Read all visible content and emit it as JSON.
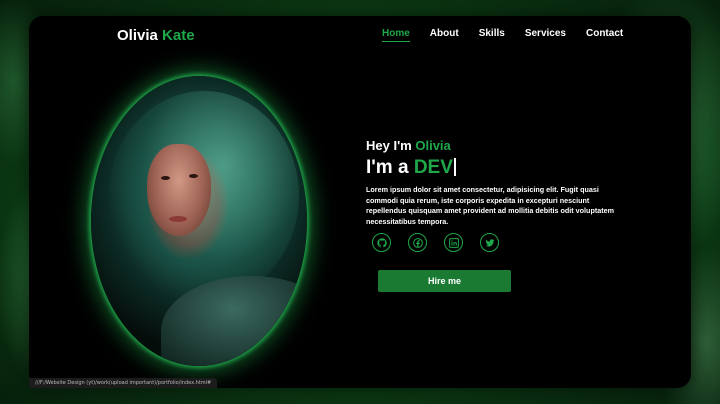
{
  "header": {
    "logo_first": "Olivia",
    "logo_second": "Kate",
    "nav": [
      {
        "label": "Home",
        "active": true
      },
      {
        "label": "About",
        "active": false
      },
      {
        "label": "Skills",
        "active": false
      },
      {
        "label": "Services",
        "active": false
      },
      {
        "label": "Contact",
        "active": false
      }
    ]
  },
  "hero": {
    "greeting_prefix": "Hey I'm",
    "greeting_name": "Olivia",
    "role_prefix": "I'm a",
    "role_word": "DEV",
    "description": "Lorem ipsum dolor sit amet consectetur, adipisicing elit. Fugit quasi commodi quia rerum, iste corporis expedita in excepturi nesciunt repellendus quisquam amet provident ad mollitia debitis odit voluptatem necessitatibus tempora.",
    "socials": [
      {
        "icon": "github-icon"
      },
      {
        "icon": "facebook-icon"
      },
      {
        "icon": "linkedin-icon"
      },
      {
        "icon": "twitter-icon"
      }
    ],
    "cta_label": "Hire me"
  },
  "statusbar": {
    "url": "///F:/Website Design (yt)/work(upload important)/portfolio/index.html#"
  },
  "colors": {
    "accent": "#1fa84a",
    "background": "#000000",
    "button": "#1a7a32"
  }
}
